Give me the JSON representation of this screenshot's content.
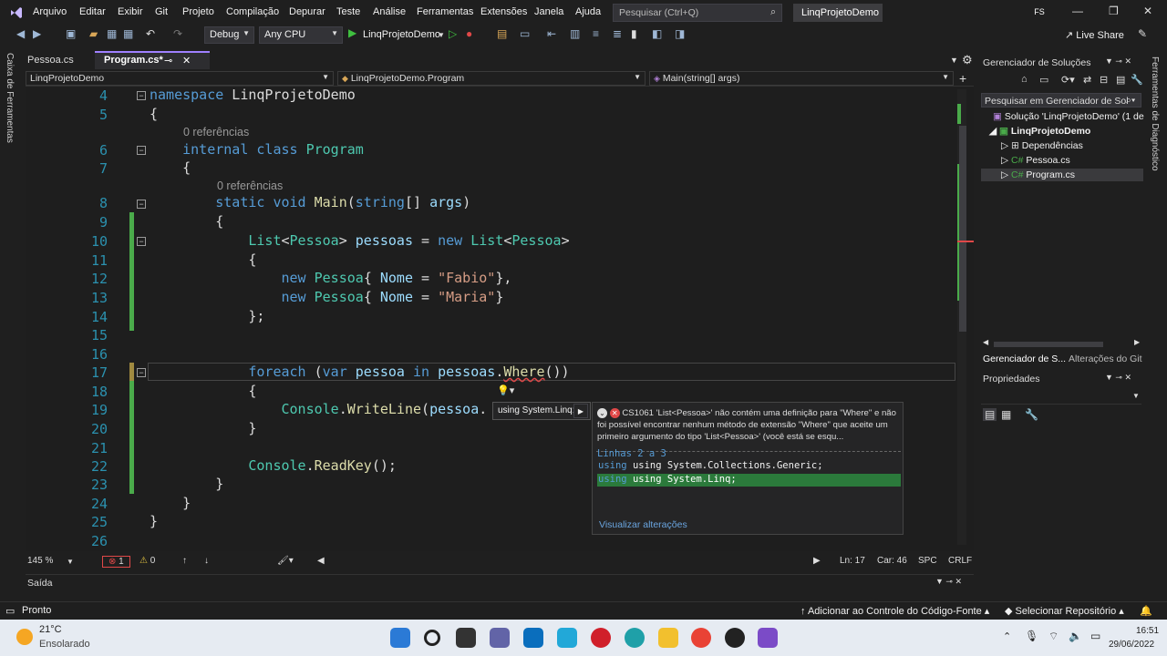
{
  "menubar": {
    "items": [
      "Arquivo",
      "Editar",
      "Exibir",
      "Git",
      "Projeto",
      "Compilação",
      "Depurar",
      "Teste",
      "Análise",
      "Ferramentas",
      "Extensões",
      "Janela",
      "Ajuda"
    ],
    "search_placeholder": "Pesquisar (Ctrl+Q)",
    "project_title": "LinqProjetoDemo",
    "user_initials": "FS"
  },
  "toolbar": {
    "config": "Debug",
    "platform": "Any CPU",
    "run_target": "LinqProjetoDemo",
    "live_share": "Live Share"
  },
  "left_strip": {
    "toolbox": "Caixa de Ferramentas"
  },
  "right_strip": {
    "diagnostics": "Ferramentas de Diagnóstico"
  },
  "tabs": [
    {
      "label": "Pessoa.cs"
    },
    {
      "label": "Program.cs*"
    }
  ],
  "navbar": {
    "project": "LinqProjetoDemo",
    "class": "LinqProjetoDemo.Program",
    "member": "Main(string[] args)"
  },
  "editor": {
    "references_label": "0 referências",
    "line_numbers": [
      "4",
      "5",
      "6",
      "7",
      "8",
      "9",
      "10",
      "11",
      "12",
      "13",
      "14",
      "15",
      "16",
      "17",
      "18",
      "19",
      "20",
      "21",
      "22",
      "23",
      "24",
      "25",
      "26"
    ],
    "line17_code": "foreach (var pessoa in pessoas.Where())"
  },
  "quick_action": {
    "menu_label": "using System.Linq;",
    "error_code": "CS1061",
    "error_text": "'List<Pessoa>' não contém uma definição para \"Where\" e não foi possível encontrar nenhum método de extensão \"Where\" que aceite um primeiro argumento do tipo 'List<Pessoa>' (você está se esqu...",
    "lines_label": "Linhas 2 a 3",
    "preview_lines": [
      "using System.Collections.Generic;",
      "using System.Linq;"
    ],
    "view_changes": "Visualizar alterações"
  },
  "editor_status": {
    "zoom": "145 %",
    "errors": "1",
    "warnings": "0",
    "line": "Ln: 17",
    "char": "Car: 46",
    "spaces": "SPC",
    "eol": "CRLF"
  },
  "solution_explorer": {
    "title": "Gerenciador de Soluções",
    "search_placeholder": "Pesquisar em Gerenciador de Sol",
    "solution": "Solução 'LinqProjetoDemo' (1 de",
    "project": "LinqProjetoDemo",
    "items": [
      "Dependências",
      "Pessoa.cs",
      "Program.cs"
    ],
    "bottom_tabs": [
      "Gerenciador de S...",
      "Alterações do Git"
    ]
  },
  "properties": {
    "title": "Propriedades"
  },
  "output": {
    "title": "Saída"
  },
  "statusbar": {
    "ready": "Pronto",
    "source_control": "Adicionar ao Controle do Código-Fonte",
    "repo": "Selecionar Repositório"
  },
  "taskbar": {
    "temperature": "21°C",
    "weather": "Ensolarado",
    "time": "16:51",
    "date": "29/06/2022"
  }
}
